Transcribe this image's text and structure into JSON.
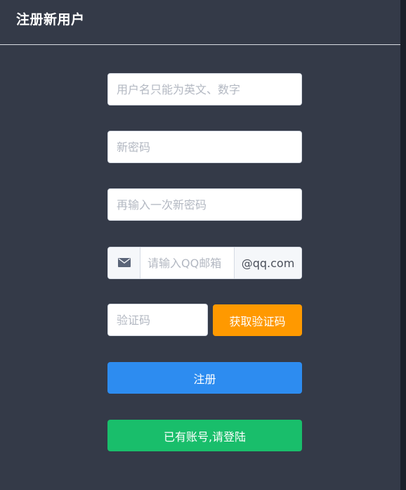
{
  "header": {
    "title": "注册新用户"
  },
  "form": {
    "username_placeholder": "用户名只能为英文、数字",
    "password_placeholder": "新密码",
    "confirm_password_placeholder": "再输入一次新密码",
    "email": {
      "icon": "mail-icon",
      "placeholder": "请输入QQ邮箱",
      "suffix": "@qq.com"
    },
    "code_placeholder": "验证码",
    "get_code_label": "获取验证码",
    "register_label": "注册",
    "login_label": "已有账号,请登陆"
  },
  "colors": {
    "panel_bg": "#343a48",
    "get_code_button": "#ff9900",
    "register_button": "#2d8cf0",
    "login_button": "#19be6b"
  }
}
